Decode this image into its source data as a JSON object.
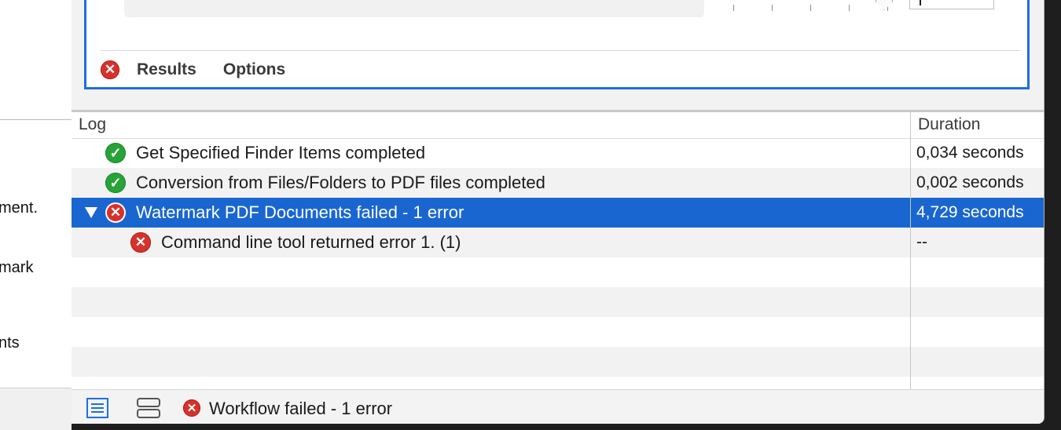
{
  "sidebar": {
    "fragments": [
      "ment.",
      "mark",
      "nts"
    ]
  },
  "action": {
    "tabs": [
      {
        "label": "Results",
        "has_error": true
      },
      {
        "label": "Options"
      }
    ]
  },
  "log": {
    "columns": {
      "log": "Log",
      "duration": "Duration"
    },
    "rows": [
      {
        "status": "success",
        "text": "Get Specified Finder Items completed",
        "duration": "0,034 seconds"
      },
      {
        "status": "success",
        "text": "Conversion from Files/Folders to PDF files completed",
        "duration": "0,002 seconds"
      },
      {
        "status": "error",
        "text": "Watermark PDF Documents failed - 1 error",
        "duration": "4,729 seconds",
        "selected": true,
        "expanded": true
      },
      {
        "status": "error",
        "text": "Command line tool returned error 1. (1)",
        "duration": "--",
        "indent": 1
      }
    ]
  },
  "status_bar": {
    "message": "Workflow failed - 1 error",
    "list_view_icon": "list-view-icon",
    "split_view_icon": "split-view-icon"
  },
  "colors": {
    "selection": "#1a66d0",
    "error": "#d6322c",
    "success": "#27a338",
    "accent_border": "#1f6ee0"
  }
}
